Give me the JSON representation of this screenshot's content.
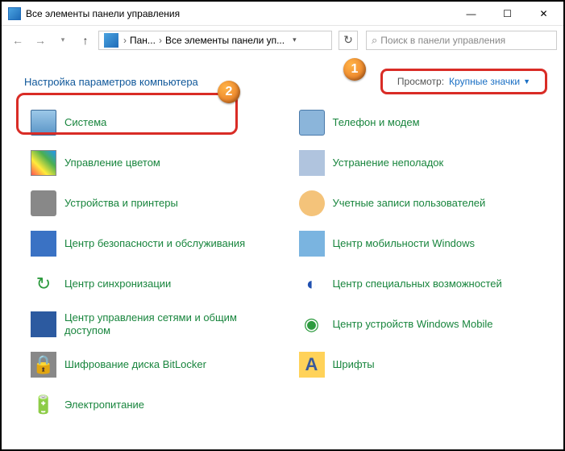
{
  "window": {
    "title": "Все элементы панели управления"
  },
  "breadcrumb": {
    "root": "Пан...",
    "current": "Все элементы панели уп..."
  },
  "search": {
    "placeholder": "Поиск в панели управления"
  },
  "header": {
    "title": "Настройка параметров компьютера",
    "view_label": "Просмотр:",
    "view_value": "Крупные значки"
  },
  "markers": {
    "m1": "1",
    "m2": "2"
  },
  "items": [
    {
      "label": "Система",
      "icon": "ic-monitor",
      "name": "item-system"
    },
    {
      "label": "Телефон и модем",
      "icon": "ic-phone",
      "name": "item-phone"
    },
    {
      "label": "Управление цветом",
      "icon": "ic-color",
      "name": "item-color"
    },
    {
      "label": "Устранение неполадок",
      "icon": "ic-wrench",
      "name": "item-troubleshoot"
    },
    {
      "label": "Устройства и принтеры",
      "icon": "ic-printer",
      "name": "item-devices"
    },
    {
      "label": "Учетные записи пользователей",
      "icon": "ic-users",
      "name": "item-accounts"
    },
    {
      "label": "Центр безопасности и обслуживания",
      "icon": "ic-flag",
      "name": "item-security"
    },
    {
      "label": "Центр мобильности Windows",
      "icon": "ic-mobility",
      "name": "item-mobility"
    },
    {
      "label": "Центр синхронизации",
      "icon": "ic-sync",
      "name": "item-sync",
      "glyph": "↻"
    },
    {
      "label": "Центр специальных возможностей",
      "icon": "ic-ease",
      "name": "item-ease",
      "glyph": "◐"
    },
    {
      "label": "Центр управления сетями и общим доступом",
      "icon": "ic-net",
      "name": "item-network"
    },
    {
      "label": "Центр устройств Windows Mobile",
      "icon": "ic-winmob",
      "name": "item-winmobile",
      "glyph": "◉"
    },
    {
      "label": "Шифрование диска BitLocker",
      "icon": "ic-bitlocker",
      "name": "item-bitlocker",
      "glyph": "🔒"
    },
    {
      "label": "Шрифты",
      "icon": "ic-font",
      "name": "item-fonts",
      "glyph": "A"
    },
    {
      "label": "Электропитание",
      "icon": "ic-power",
      "name": "item-power",
      "glyph": "🔋"
    }
  ]
}
